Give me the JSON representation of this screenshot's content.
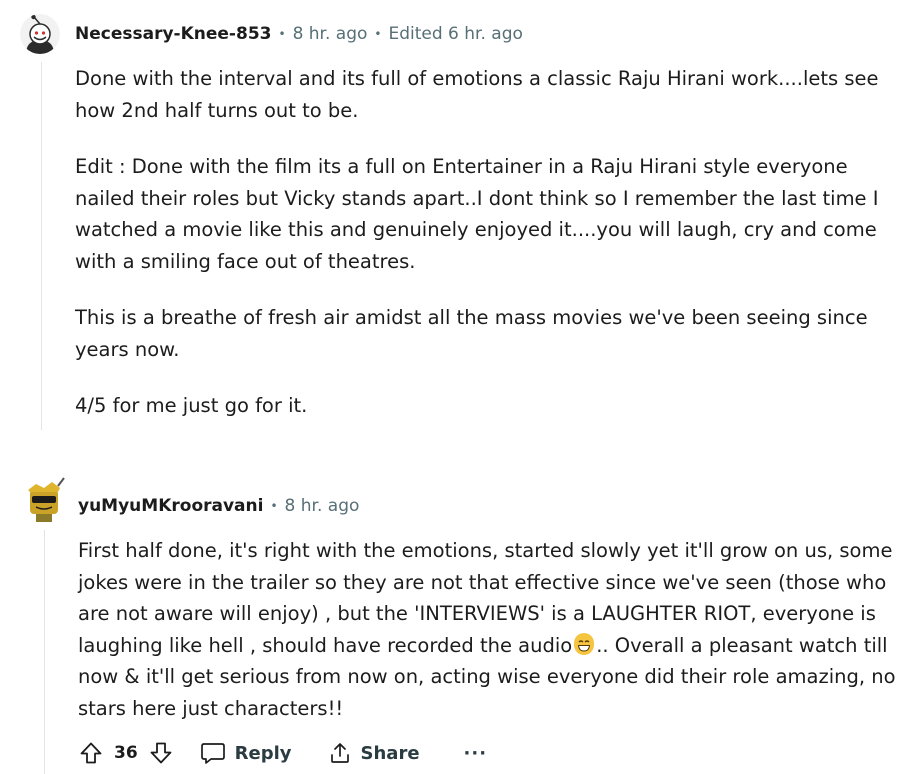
{
  "comments": [
    {
      "author": "Necessary-Knee-853",
      "time": "8 hr. ago",
      "edited": "Edited 6 hr. ago",
      "paragraphs": [
        [
          "Done with the interval and its full of emotions a classic Raju Hirani work....lets see",
          "how 2nd half turns out to be."
        ],
        [
          "Edit : Done with the film its a full on Entertainer in a Raju Hirani style everyone",
          "nailed their roles but Vicky stands apart..I dont think so I remember the last time I",
          "watched a movie like this and genuinely enjoyed it....you will laugh, cry and come",
          "with a smiling face out of theatres."
        ],
        [
          "This is a breathe of fresh air amidst all the mass movies we've been seeing since",
          "years now."
        ],
        [
          "4/5 for me just go for it."
        ]
      ]
    },
    {
      "author": "yuMyuMKrooravani",
      "time": "8 hr. ago",
      "paragraphs": [
        [
          "First half done, it's right with the emotions, started slowly yet it'll grow on us, some",
          "jokes were in the trailer so they are not that effective since we've seen (those who",
          "are not aware will enjoy) , but the 'INTERVIEWS' is a LAUGHTER RIOT, everyone is",
          "laughing like hell , should have recorded the audio",
          ".. Overall a pleasant watch till",
          "now & it'll get serious from now on, acting wise everyone did their role amazing, no",
          "stars here just characters!!"
        ]
      ],
      "actions": {
        "score": "36",
        "reply_label": "Reply",
        "share_label": "Share",
        "more_label": "···"
      }
    }
  ],
  "icons": {
    "upvote": "upvote-icon",
    "downvote": "downvote-icon",
    "reply": "reply-bubble-icon",
    "share": "share-icon",
    "emoji": "grinning-face-emoji"
  },
  "colors": {
    "text": "#1c1c1c",
    "meta": "#576f76",
    "thread_line": "#e5e5e5"
  }
}
